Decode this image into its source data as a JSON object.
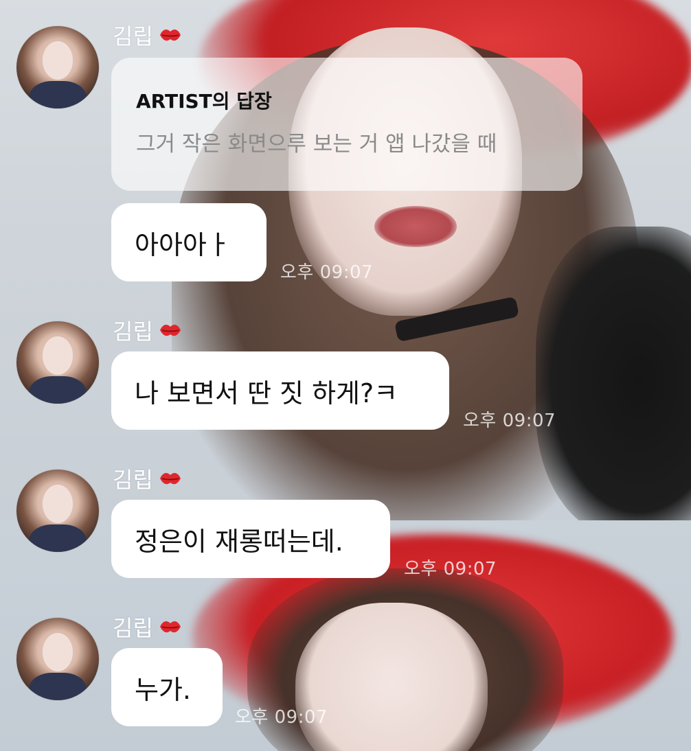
{
  "sender": {
    "name": "김립",
    "avatar_icon": "profile-photo",
    "name_icon": "kiss-lips-icon"
  },
  "reply_preview": {
    "title": "ARTIST의 답장",
    "text": "그거 작은 화면으루 보는 거 앱 나갔을 때"
  },
  "messages": [
    {
      "text": "아아아ㅏ",
      "time": "오후 09:07"
    },
    {
      "text": "나 보면서 딴 짓 하게?ㅋ",
      "time": "오후 09:07"
    },
    {
      "text": "정은이 재롱떠는데.",
      "time": "오후 09:07"
    },
    {
      "text": "누가.",
      "time": "오후 09:07"
    }
  ],
  "colors": {
    "bubble": "#ffffff",
    "lips_accent": "#e0262d",
    "fur_red": "#c81f24"
  }
}
